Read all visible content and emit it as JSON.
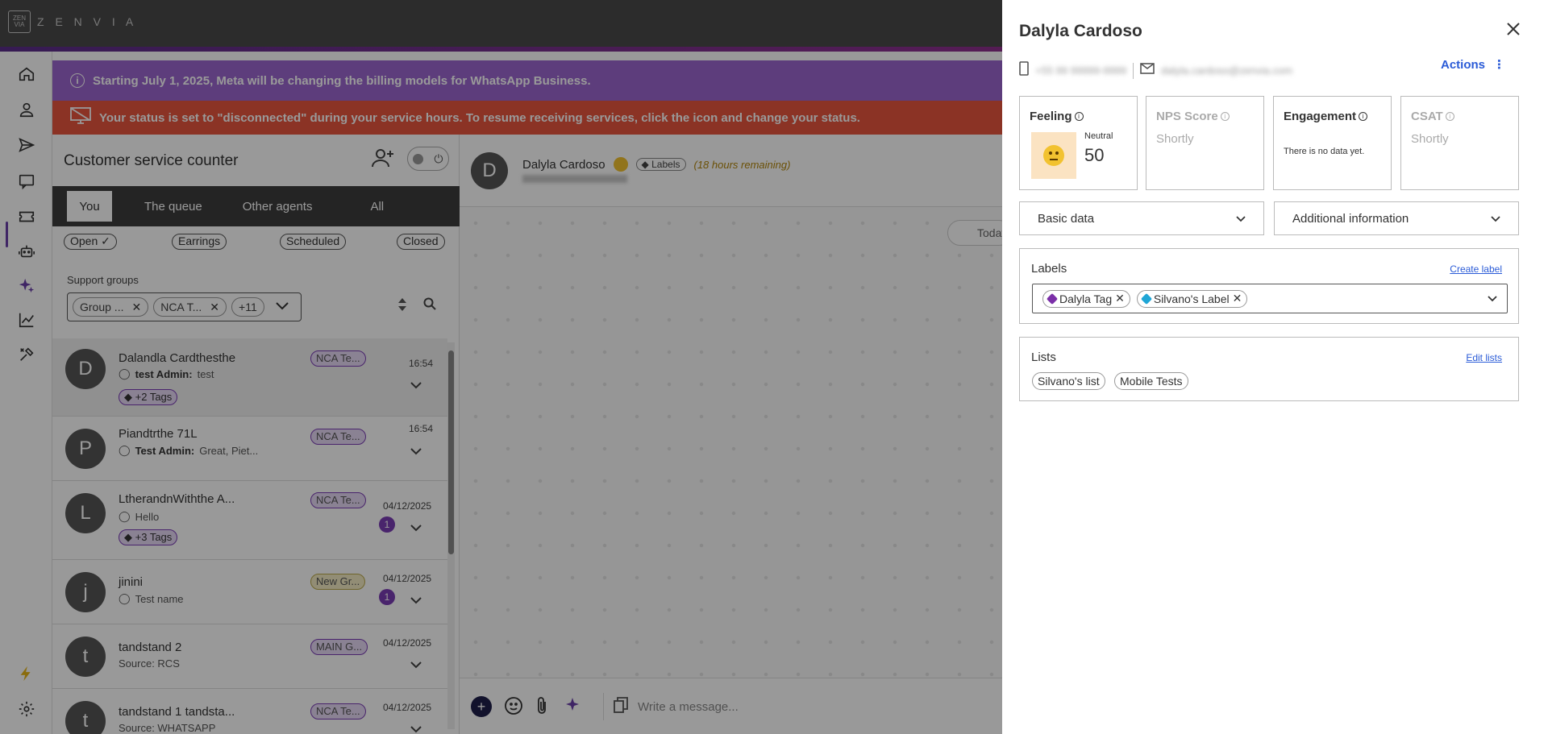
{
  "app": {
    "brand_logo_text": "ZEN VIA",
    "brand": "Z E N V I A"
  },
  "banners": {
    "meta": "Starting July 1, 2025, Meta will be changing the billing models for WhatsApp Business.",
    "status": "Your status is set to \"disconnected\" during your service hours. To resume receiving services, click the icon and change your status."
  },
  "list_panel": {
    "title": "Customer service counter",
    "tabs": [
      "You",
      "The queue",
      "Other agents",
      "All"
    ],
    "filters": [
      "Open",
      "Earrings",
      "Scheduled",
      "Closed"
    ],
    "support_groups_label": "Support groups",
    "group_chips": [
      "Group ...",
      "NCA T...",
      "+11"
    ],
    "conversations": [
      {
        "initial": "D",
        "name": "Dalandla Cardthesthe",
        "sender": "test Admin:",
        "message": "test",
        "group": "NCA Te...",
        "time": "16:54",
        "tags": "+2 Tags",
        "unread": ""
      },
      {
        "initial": "P",
        "name": "Piandtrthe 71L",
        "sender": "Test Admin:",
        "message": "Great, Piet...",
        "group": "NCA Te...",
        "time": "16:54",
        "tags": "",
        "unread": ""
      },
      {
        "initial": "L",
        "name": "LtherandnWiththe A...",
        "sender": "",
        "message": "Hello",
        "group": "NCA Te...",
        "time": "04/12/2025",
        "tags": "+3 Tags",
        "unread": "1"
      },
      {
        "initial": "j",
        "name": "jinini",
        "sender": "",
        "message": "Test name",
        "group": "New Gr...",
        "time": "04/12/2025",
        "tags": "",
        "unread": "1"
      },
      {
        "initial": "t",
        "name": "tandstand 2",
        "sender": "",
        "message": "Source: RCS",
        "group": "MAIN G...",
        "time": "04/12/2025",
        "tags": "",
        "unread": ""
      },
      {
        "initial": "t",
        "name": "tandstand 1 tandsta...",
        "sender": "",
        "message": "Source: WHATSAPP",
        "group": "NCA Te...",
        "time": "04/12/2025",
        "tags": "",
        "unread": ""
      }
    ]
  },
  "chat": {
    "contact_initial": "D",
    "contact_name": "Dalyla Cardoso",
    "labels_chip": "Labels",
    "remaining": "(18 hours remaining)",
    "today": "Today",
    "composer_placeholder": "Write a message..."
  },
  "drawer": {
    "title": "Dalyla Cardoso",
    "phone": "+55 99 99999-9999",
    "email": "dalyla.cardoso@zenvia.com",
    "actions": "Actions",
    "metrics": {
      "feeling": {
        "title": "Feeling",
        "mood": "Neutral",
        "score": "50"
      },
      "nps": {
        "title": "NPS Score",
        "value": "Shortly"
      },
      "engagement": {
        "title": "Engagement",
        "value": "There is no data yet."
      },
      "csat": {
        "title": "CSAT",
        "value": "Shortly"
      }
    },
    "dropdowns": [
      "Basic data",
      "Additional information"
    ],
    "labels": {
      "title": "Labels",
      "link": "Create label",
      "items": [
        {
          "text": "Dalyla Tag",
          "color": "#7b2fa8"
        },
        {
          "text": "Silvano's Label",
          "color": "#1fa6d6"
        }
      ]
    },
    "lists": {
      "title": "Lists",
      "link": "Edit lists",
      "items": [
        "Silvano's list",
        "Mobile Tests"
      ]
    }
  },
  "colors": {
    "accent": "#6a3fa8",
    "meta_banner": "#9c67cf",
    "status_banner": "#e8553e",
    "link": "#2a5bd7"
  }
}
